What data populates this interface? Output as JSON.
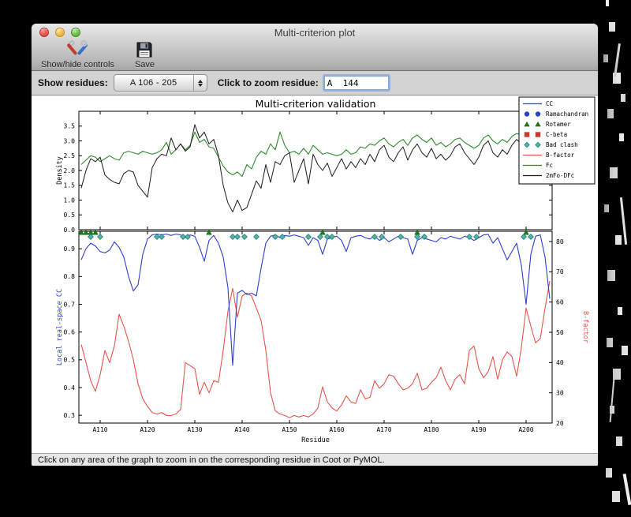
{
  "window": {
    "title": "Multi-criterion plot",
    "toolbar": {
      "show_hide_label": "Show/hide controls",
      "save_label": "Save"
    },
    "controls": {
      "show_residues_label": "Show residues:",
      "residue_range_value": "A 106 - 205",
      "zoom_residue_label": "Click to zoom residue:",
      "zoom_residue_value": "A  144"
    },
    "status_bar": "Click on any area of the graph to zoom in on the corresponding residue in Coot or PyMOL."
  },
  "chart_data": {
    "type": "line",
    "title": "Multi-criterion validation",
    "xlabel": "Residue",
    "xlim": [
      105.5,
      205.5
    ],
    "x_first_residue": 106,
    "x_tick_residues": [
      110,
      120,
      130,
      140,
      150,
      160,
      170,
      180,
      190,
      200
    ],
    "x_tick_labels": [
      "A110",
      "A120",
      "A130",
      "A140",
      "A150",
      "A160",
      "A170",
      "A180",
      "A190",
      "A200"
    ],
    "legend": [
      {
        "label": "CC",
        "type": "line",
        "color": "#2b3fd0"
      },
      {
        "label": "Ramachandran",
        "type": "circle",
        "color": "#2b3fd0"
      },
      {
        "label": "Rotamer",
        "type": "triangle",
        "color": "#1e7a1e"
      },
      {
        "label": "C-beta",
        "type": "square",
        "color": "#cc3a2c"
      },
      {
        "label": "Bad clash",
        "type": "diamond",
        "color": "#4fb4aa"
      },
      {
        "label": "B-factor",
        "type": "line",
        "color": "#e8564c"
      },
      {
        "label": "Fc",
        "type": "line",
        "color": "#2e8b2e"
      },
      {
        "label": "2mFo-DFc",
        "type": "line",
        "color": "#1a1a1a"
      }
    ],
    "top_panel": {
      "ylabel": "Density",
      "ylim": [
        0,
        4.0
      ],
      "yticks": [
        0.0,
        0.5,
        1.0,
        1.5,
        2.0,
        2.5,
        3.0,
        3.5
      ],
      "series": [
        {
          "name": "Fc",
          "color": "#2e8b2e",
          "values": [
            2.2,
            2.35,
            2.5,
            2.45,
            2.3,
            2.4,
            2.5,
            2.4,
            2.35,
            2.6,
            2.65,
            2.6,
            2.55,
            2.65,
            2.6,
            2.55,
            2.6,
            2.7,
            2.95,
            2.55,
            2.7,
            2.9,
            2.7,
            2.85,
            3.3,
            2.95,
            3.05,
            2.8,
            2.75,
            2.45,
            2.15,
            1.95,
            1.85,
            1.95,
            1.8,
            2.2,
            2.05,
            2.45,
            2.65,
            2.55,
            2.9,
            2.7,
            3.3,
            2.85,
            2.6,
            2.65,
            2.55,
            2.75,
            2.55,
            2.85,
            2.7,
            2.55,
            2.6,
            2.55,
            2.5,
            2.55,
            2.7,
            2.55,
            2.6,
            2.8,
            2.75,
            2.9,
            2.85,
            3.0,
            3.1,
            2.9,
            2.8,
            2.95,
            3.05,
            2.85,
            3.1,
            3.2,
            3.05,
            2.95,
            3.1,
            2.85,
            2.95,
            2.8,
            2.9,
            3.05,
            3.1,
            2.95,
            2.85,
            2.75,
            2.85,
            3.1,
            3.2,
            3.0,
            2.9,
            3.05,
            2.95,
            3.15,
            3.25,
            3.2,
            3.05,
            3.2,
            3.25,
            2.85,
            3.2,
            2.55
          ]
        },
        {
          "name": "2mFo-DFc",
          "color": "#1a1a1a",
          "values": [
            1.4,
            2.0,
            2.4,
            2.3,
            2.45,
            1.85,
            1.7,
            1.6,
            1.55,
            1.9,
            2.0,
            1.95,
            1.5,
            1.3,
            1.1,
            2.1,
            2.4,
            2.55,
            2.5,
            3.1,
            2.7,
            2.9,
            2.65,
            2.8,
            3.55,
            3.1,
            3.3,
            2.9,
            3.05,
            2.5,
            1.5,
            0.9,
            0.6,
            1.0,
            0.65,
            0.75,
            1.2,
            1.65,
            1.4,
            2.2,
            1.6,
            2.3,
            2.2,
            2.5,
            2.6,
            1.6,
            2.0,
            2.4,
            1.55,
            2.55,
            2.2,
            2.0,
            2.25,
            1.8,
            2.1,
            2.4,
            2.05,
            2.3,
            2.1,
            2.4,
            2.2,
            2.55,
            2.3,
            2.7,
            2.85,
            2.45,
            2.3,
            2.6,
            2.8,
            2.35,
            2.7,
            2.9,
            2.6,
            2.45,
            2.75,
            2.4,
            2.55,
            2.35,
            2.5,
            2.8,
            2.9,
            2.6,
            2.4,
            2.2,
            2.45,
            2.85,
            3.0,
            2.6,
            2.45,
            2.7,
            2.55,
            2.85,
            3.05,
            2.9,
            2.6,
            2.9,
            3.1,
            1.65,
            2.9,
            2.05
          ]
        }
      ]
    },
    "bottom_panel": {
      "left_axis": {
        "ylabel": "Local real-space CC",
        "color": "#2b3fd0",
        "ylim": [
          0.272,
          0.963
        ],
        "yticks": [
          0.3,
          0.4,
          0.5,
          0.6,
          0.7,
          0.8,
          0.9
        ]
      },
      "right_axis": {
        "ylabel": "B-factor",
        "color": "#e8564c",
        "ylim": [
          20,
          83.4
        ],
        "yticks": [
          20,
          30,
          40,
          50,
          60,
          70,
          80
        ]
      },
      "series": [
        {
          "name": "CC",
          "axis": "left",
          "color": "#2b3fd0",
          "values": [
            0.86,
            0.9,
            0.92,
            0.91,
            0.89,
            0.885,
            0.895,
            0.925,
            0.905,
            0.87,
            0.8,
            0.748,
            0.77,
            0.88,
            0.935,
            0.95,
            0.953,
            0.95,
            0.953,
            0.948,
            0.953,
            0.95,
            0.94,
            0.95,
            0.945,
            0.905,
            0.855,
            0.93,
            0.948,
            0.92,
            0.87,
            0.76,
            0.48,
            0.74,
            0.75,
            0.735,
            0.74,
            0.73,
            0.83,
            0.92,
            0.945,
            0.95,
            0.94,
            0.948,
            0.945,
            0.95,
            0.945,
            0.94,
            0.912,
            0.94,
            0.93,
            0.88,
            0.935,
            0.94,
            0.945,
            0.93,
            0.89,
            0.94,
            0.945,
            0.948,
            0.94,
            0.935,
            0.945,
            0.93,
            0.94,
            0.925,
            0.935,
            0.945,
            0.94,
            0.935,
            0.88,
            0.93,
            0.94,
            0.935,
            0.93,
            0.925,
            0.94,
            0.935,
            0.945,
            0.94,
            0.935,
            0.945,
            0.94,
            0.93,
            0.94,
            0.95,
            0.952,
            0.92,
            0.94,
            0.9,
            0.86,
            0.89,
            0.92,
            0.84,
            0.7,
            0.88,
            0.945,
            0.95,
            0.87,
            0.72
          ]
        },
        {
          "name": "B-factor",
          "axis": "right",
          "color": "#e8564c",
          "values": [
            46,
            40,
            34,
            30.5,
            36,
            44,
            40,
            45.5,
            56,
            52,
            47,
            41,
            33,
            28,
            25.5,
            23.5,
            23,
            23.5,
            22.5,
            22.5,
            23,
            24.5,
            40,
            39,
            38,
            29.5,
            33.5,
            30,
            34,
            33.5,
            44,
            57,
            64.5,
            55,
            62,
            63,
            62,
            58,
            54,
            44,
            30,
            24,
            23,
            22.5,
            21.8,
            22.5,
            22,
            22.5,
            22,
            23,
            25,
            32,
            27,
            25,
            24,
            26,
            29,
            27,
            26.5,
            31,
            28,
            28.5,
            34,
            31.5,
            33,
            36,
            35.5,
            33,
            31,
            31.5,
            33,
            36.5,
            31,
            31.5,
            33.5,
            35,
            38.5,
            34,
            31,
            34.5,
            36,
            33,
            44,
            45.5,
            38,
            35,
            37,
            42,
            34.5,
            41,
            43.5,
            42,
            35.5,
            45,
            58,
            52,
            46.5,
            48,
            58,
            67
          ]
        }
      ],
      "outlier_markers": [
        {
          "name": "Rotamer",
          "shape": "triangle",
          "color": "#1e7a1e",
          "residues": [
            106,
            107,
            108,
            109,
            133,
            157,
            177,
            200
          ]
        },
        {
          "name": "Bad clash",
          "shape": "diamond",
          "color": "#4fb4aa",
          "residues": [
            108,
            110,
            122,
            123,
            127.5,
            128.5,
            138,
            139,
            140.5,
            143,
            147,
            148.5,
            154,
            156.5,
            158,
            159,
            168,
            169.5,
            173.5,
            177,
            178.5,
            188,
            189.5,
            199.5,
            201
          ]
        },
        {
          "name": "Ramachandran",
          "shape": "circle",
          "color": "#2b3fd0",
          "residues": []
        },
        {
          "name": "C-beta",
          "shape": "square",
          "color": "#cc3a2c",
          "residues": []
        }
      ]
    }
  }
}
